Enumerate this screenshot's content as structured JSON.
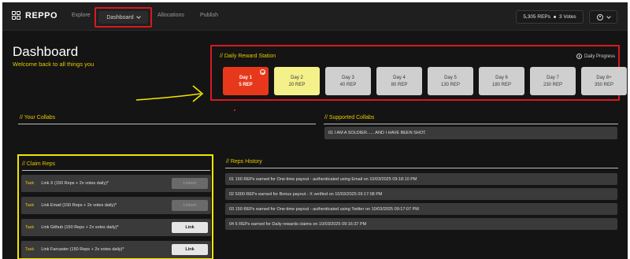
{
  "nav": {
    "brand": "REPPO",
    "links": [
      "Explore",
      "Dashboard",
      "Allocations",
      "Publish"
    ],
    "reps": "5,305 REPs",
    "votes": "3 Votes"
  },
  "header": {
    "title": "Dashboard",
    "subtitle": "Welcome back to all things you"
  },
  "daily": {
    "title": "// Daily Reward Station",
    "progress": "Daily Progress",
    "days": [
      {
        "label": "Day 1",
        "reward": "5 REP",
        "state": "active"
      },
      {
        "label": "Day 2",
        "reward": "20 REP",
        "state": "next"
      },
      {
        "label": "Day 3",
        "reward": "40 REP",
        "state": "locked"
      },
      {
        "label": "Day 4",
        "reward": "80 REP",
        "state": "locked"
      },
      {
        "label": "Day 5",
        "reward": "130 REP",
        "state": "locked"
      },
      {
        "label": "Day 6",
        "reward": "180 REP",
        "state": "locked"
      },
      {
        "label": "Day 7",
        "reward": "230 REP",
        "state": "locked"
      },
      {
        "label": "Day 8+",
        "reward": "350 REP",
        "state": "locked"
      }
    ]
  },
  "collabs": {
    "title": "// Your Collabs"
  },
  "supported": {
    "title": "// Supported Collabs",
    "items": [
      "01  I AM A SOLDIER...... AND I HAVE BEEN SHOT."
    ]
  },
  "claim": {
    "title": "// Claim Reps",
    "tasks": [
      {
        "tag": "Task",
        "label": "Link X (150 Reps + 2x votes daily)*",
        "button": "Linked",
        "state": "linked"
      },
      {
        "tag": "Task",
        "label": "Link Email (150 Reps + 2x votes daily)*",
        "button": "Linked",
        "state": "linked"
      },
      {
        "tag": "Task",
        "label": "Link Github (150 Reps + 2x votes daily)*",
        "button": "Link",
        "state": "link"
      },
      {
        "tag": "Task",
        "label": "Link Farcaster (150 Reps + 2x votes daily)*",
        "button": "Link",
        "state": "link"
      }
    ]
  },
  "history": {
    "title": "// Reps History",
    "items": [
      "01  150 REPs earned for One-time payout - authenticated using Email on 10/03/2025 09:18:10 PM",
      "02  5000 REPs earned for Bonus payout - X verified on 10/03/2025 09:17:08 PM",
      "03  150 REPs earned for One-time payout - authenticated using Twitter on 10/03/2025 09:17:07 PM",
      "04  5 REPs earned for Daily rewards claims on 10/03/2025 09:16:37 PM"
    ]
  },
  "colors": {
    "accent_yellow": "#e8c800",
    "annotation_red": "#d8191f",
    "annotation_yellow": "#f2e600",
    "day_active": "#e8381c",
    "day_next": "#f4f08a",
    "day_locked": "#cfcfcf"
  }
}
